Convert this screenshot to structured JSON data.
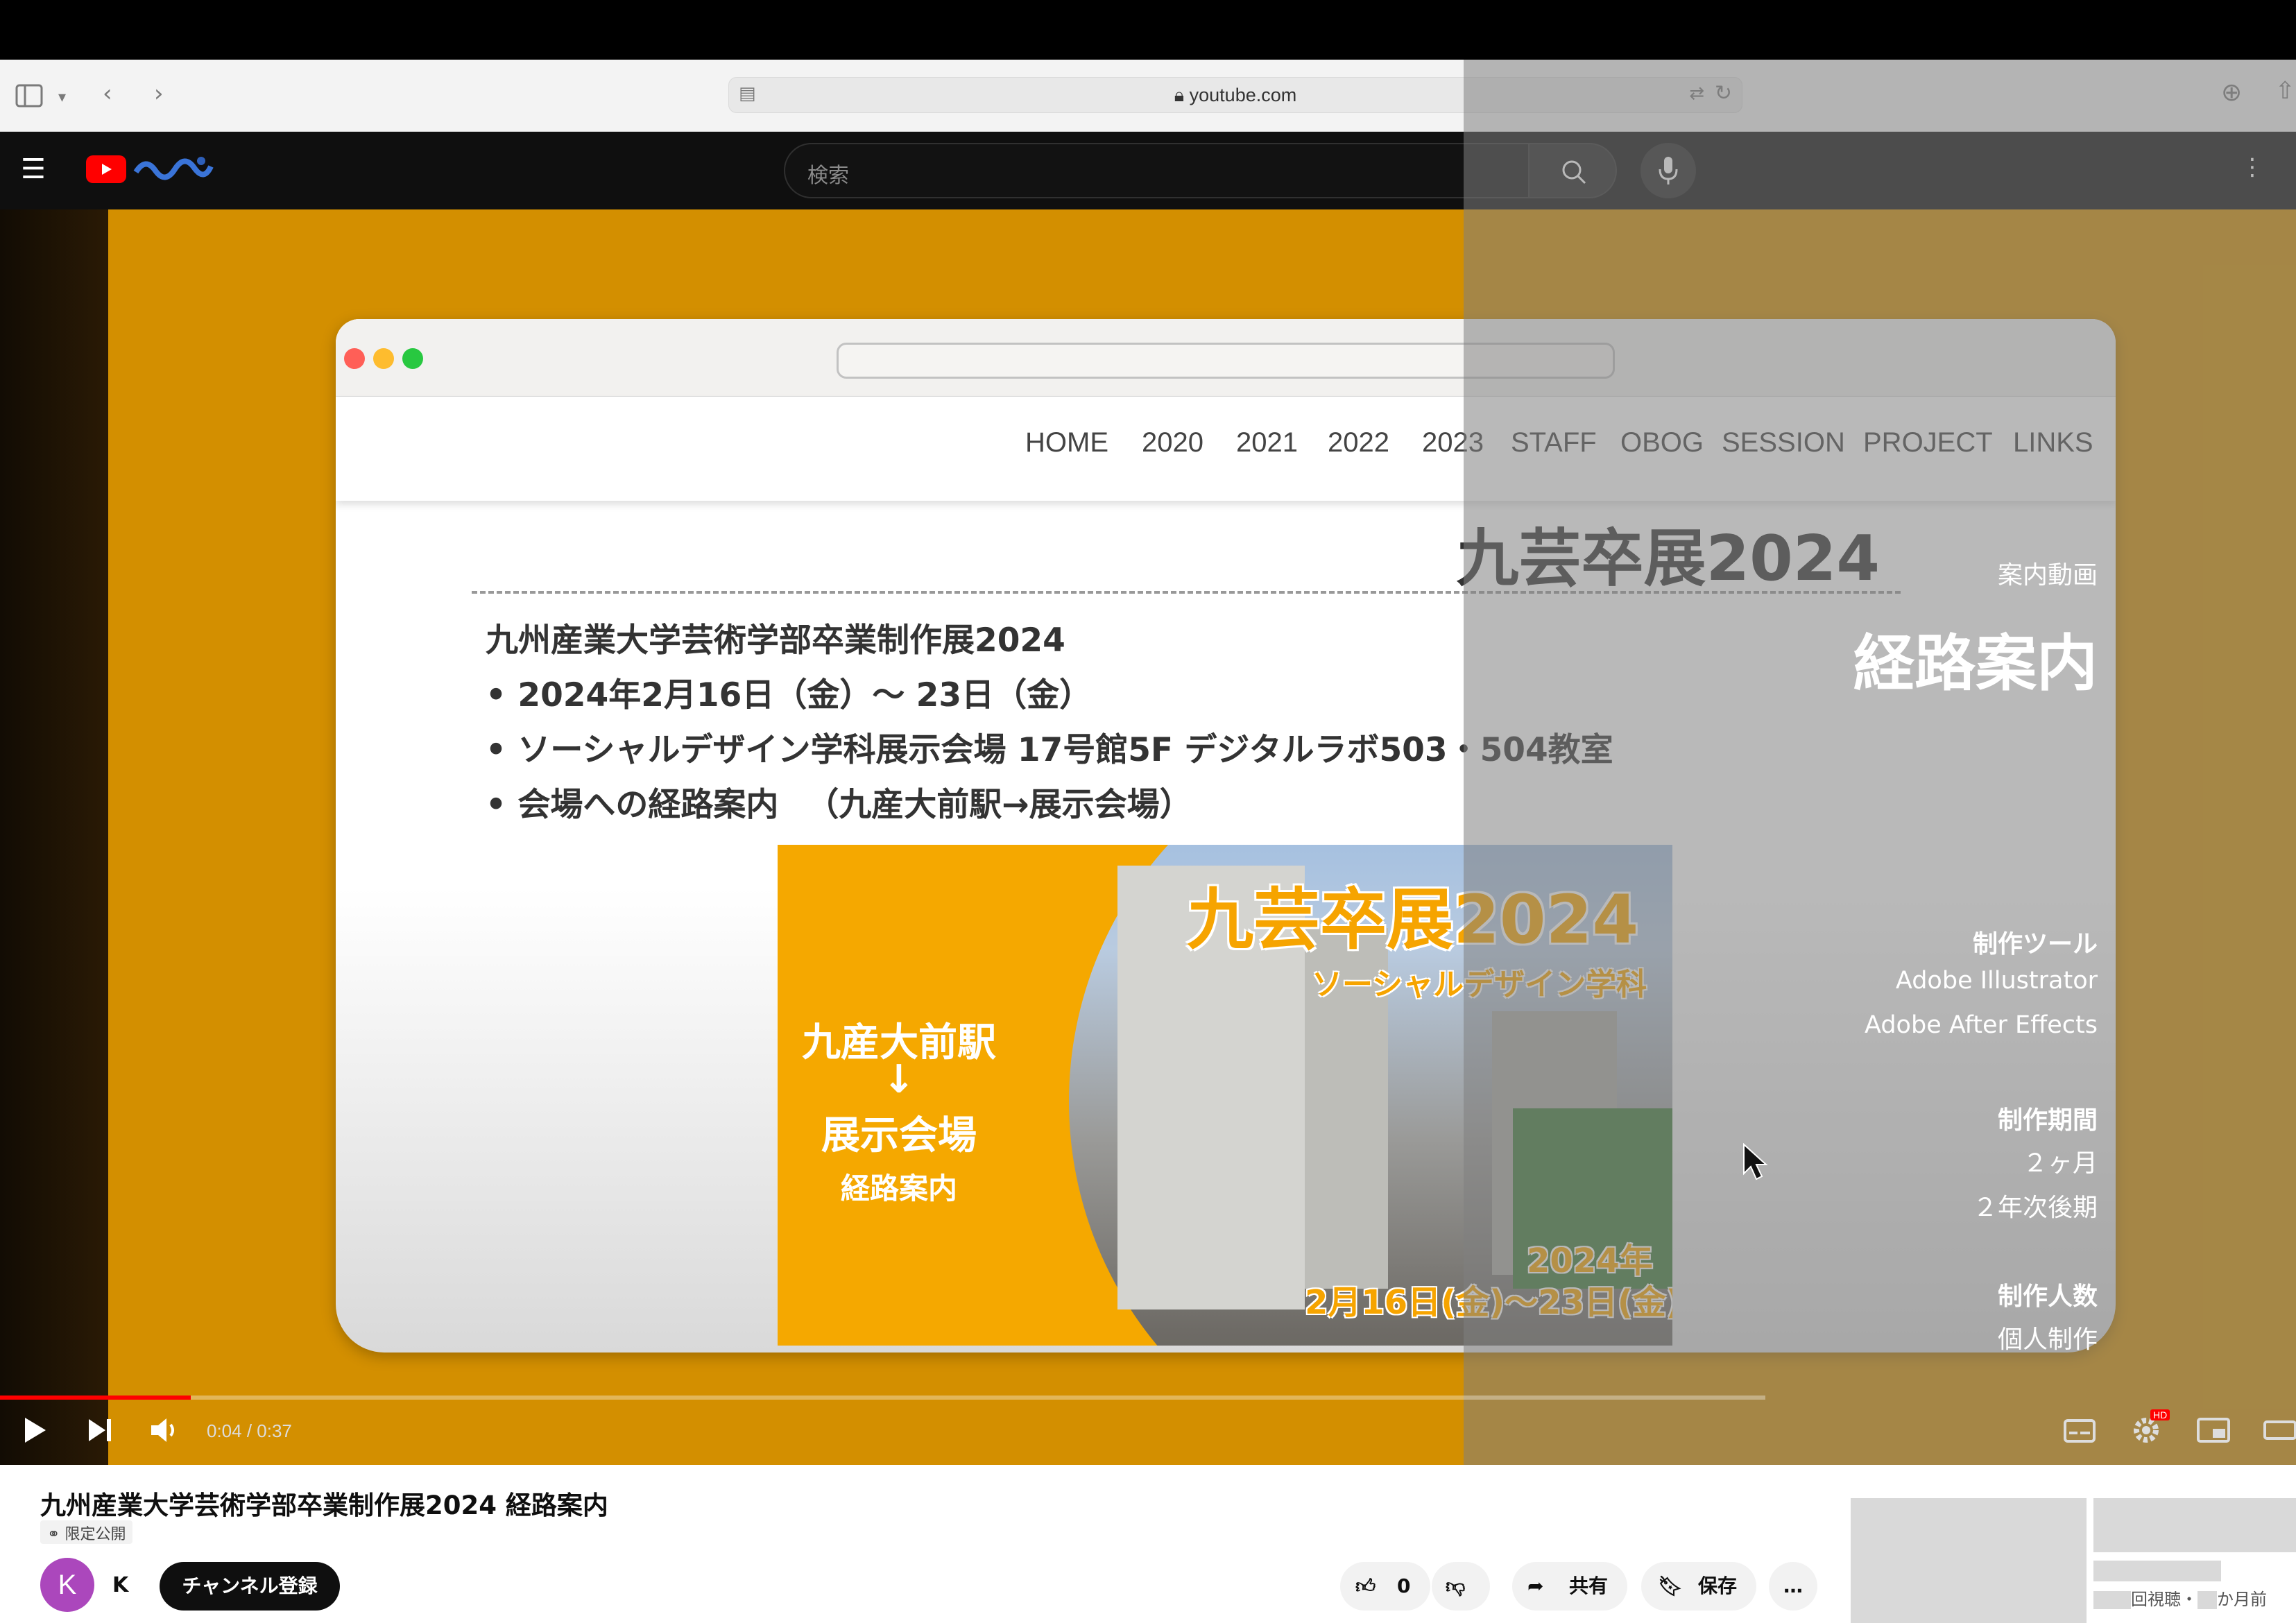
{
  "browser": {
    "url": "youtube.com"
  },
  "youtube_header": {
    "search_placeholder": "検索"
  },
  "video_frame": {
    "mock_site_nav": [
      "HOME",
      "2020",
      "2021",
      "2022",
      "2023",
      "STAFF",
      "OBOG",
      "SESSION",
      "PROJECT",
      "LINKS"
    ],
    "mock_heading": "九芸卒展2024",
    "mock_lines": [
      "九州産業大学芸術学部卒業制作展2024",
      "• 2024年2月16日（金）～ 23日（金）",
      "• ソーシャルデザイン学科展示会場 17号館5F デジタルラボ503・504教室",
      "• 会場への経路案内 　（九産大前駅→展示会場）"
    ],
    "thumbnail": {
      "title": "九芸卒展2024",
      "subtitle": "ソーシャルデザイン学科",
      "from": "九産大前駅",
      "arrow": "↓",
      "to": "展示会場",
      "label": "経路案内",
      "date_year": "2024年",
      "date_range": "2月16日(金)～23日(金)"
    },
    "right_panel": {
      "category": "案内動画",
      "title": "経路案内",
      "tools_heading": "制作ツール",
      "tools": [
        "Adobe Illustrator",
        "Adobe After Effects"
      ],
      "period_heading": "制作期間",
      "period": [
        "２ヶ月",
        "２年次後期"
      ],
      "people_heading": "制作人数",
      "people": "個人制作"
    }
  },
  "player": {
    "time": "0:04 / 0:37",
    "progress": 0.108,
    "hd_badge": "HD"
  },
  "video_info": {
    "title": "九州産業大学芸術学部卒業制作展2024 経路案内",
    "visibility": "限定公開",
    "channel_initial": "K",
    "channel_name": "K",
    "subscribe_label": "チャンネル登録",
    "like_count": "0",
    "share_label": "共有",
    "save_label": "保存",
    "more_label": "…"
  },
  "suggestion": {
    "meta": "回視聴・",
    "ago": "か月前"
  },
  "colors": {
    "video_bg": "#d38f00",
    "yt_red": "#ff0000",
    "avatar": "#ab47bc"
  }
}
